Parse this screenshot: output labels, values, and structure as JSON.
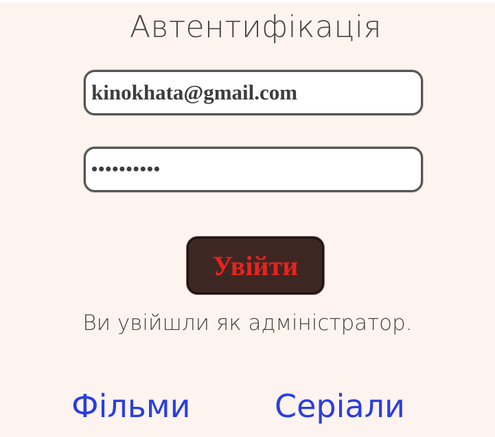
{
  "title": "Автентифікація",
  "form": {
    "email_value": "kinokhata@gmail.com",
    "password_value": "••••••••••",
    "login_label": "Увійти"
  },
  "status_text": "Ви увійшли як адміністратор.",
  "nav": {
    "films_label": "Фільми",
    "series_label": "Серіали"
  },
  "colors": {
    "background": "#fdf3ef",
    "button_bg": "#3e2723",
    "button_text": "#e8231d",
    "link": "#2a3ee0",
    "text": "#4a4541"
  }
}
